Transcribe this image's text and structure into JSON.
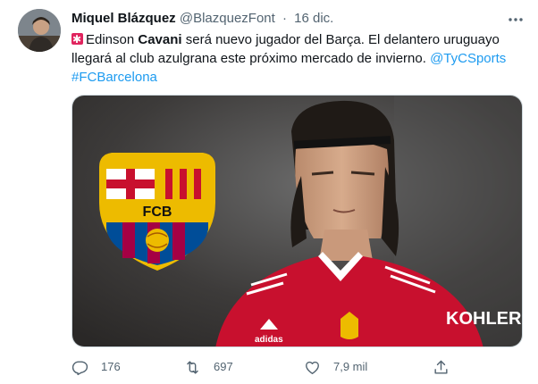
{
  "tweet": {
    "author_name": "Miquel Blázquez",
    "handle": "@BlazquezFont",
    "separator": "·",
    "date": "16 dic.",
    "text": {
      "part1": "Edinson ",
      "bold": "Cavani",
      "part2": " será nuevo jugador del Barça. El delantero uruguayo llegará al club azulgrana este próximo mercado de invierno. ",
      "mention": "@TyCSports",
      "hashtag": "#FCBarcelona"
    },
    "media": {
      "crest_letters": "FCB",
      "shirt_sponsor": "KOHLER",
      "shirt_brand": "adidas"
    },
    "actions": {
      "replies": "176",
      "retweets": "697",
      "likes": "7,9 mil"
    },
    "icons": {
      "avatar": "avatar",
      "more": "more-icon",
      "flag": "alert-emoji-icon",
      "reply": "reply-icon",
      "retweet": "retweet-icon",
      "like": "heart-icon",
      "share": "share-icon"
    },
    "colors": {
      "link": "#1d9bf0",
      "muted": "#536471",
      "text": "#0f1419",
      "shirt": "#c8102e",
      "barca_blue": "#004d98",
      "barca_red": "#a50044"
    }
  }
}
